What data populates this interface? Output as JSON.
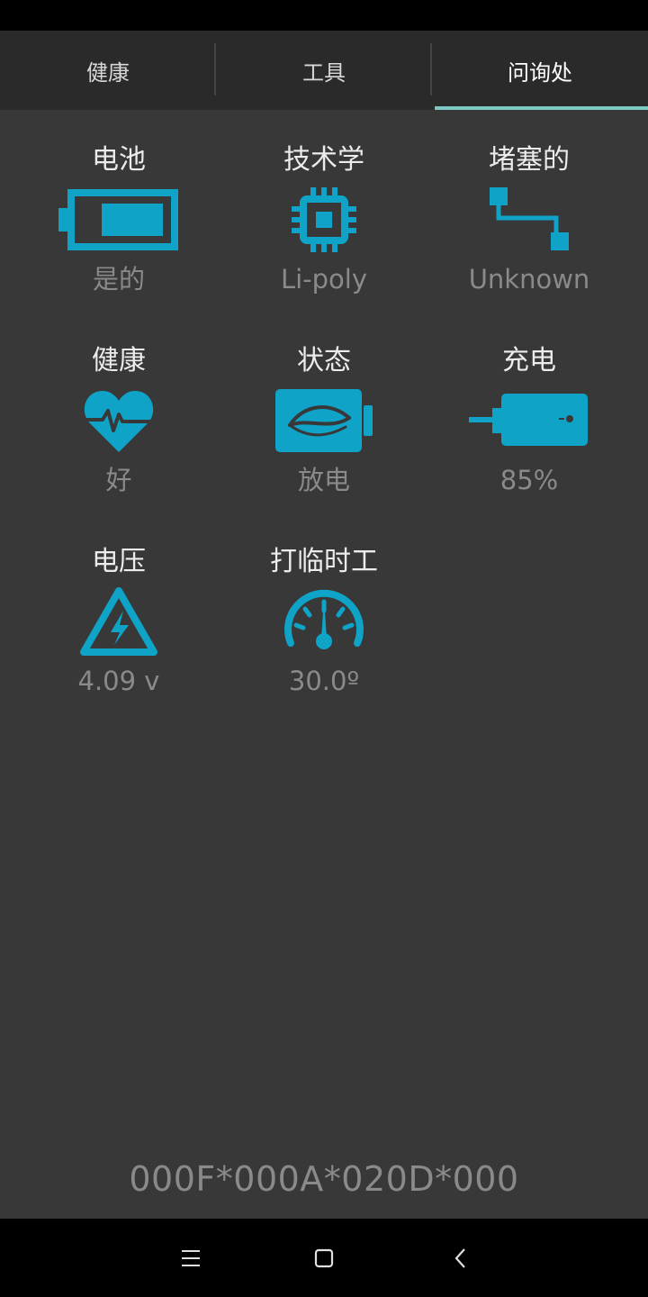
{
  "tabs": [
    {
      "label": "健康",
      "active": false
    },
    {
      "label": "工具",
      "active": false
    },
    {
      "label": "问询处",
      "active": true
    }
  ],
  "accent_color": "#0ea3c7",
  "indicator_color": "#7ec8c4",
  "info": [
    {
      "title": "电池",
      "value": "是的",
      "icon": "battery-icon"
    },
    {
      "title": "技术学",
      "value": "Li-poly",
      "icon": "chip-icon"
    },
    {
      "title": "堵塞的",
      "value": "Unknown",
      "icon": "plug-connector-icon"
    },
    {
      "title": "健康",
      "value": "好",
      "icon": "heart-pulse-icon"
    },
    {
      "title": "状态",
      "value": "放电",
      "icon": "battery-leaf-icon"
    },
    {
      "title": "充电",
      "value": "85%",
      "icon": "phone-charging-icon"
    },
    {
      "title": "电压",
      "value": "4.09 v",
      "icon": "high-voltage-icon"
    },
    {
      "title": "打临时工",
      "value": "30.0º",
      "icon": "gauge-icon"
    }
  ],
  "footer_code": "000F*000A*020D*000",
  "nav": {
    "menu_icon": "menu-icon",
    "home_icon": "home-square-icon",
    "back_icon": "back-chevron-icon"
  }
}
